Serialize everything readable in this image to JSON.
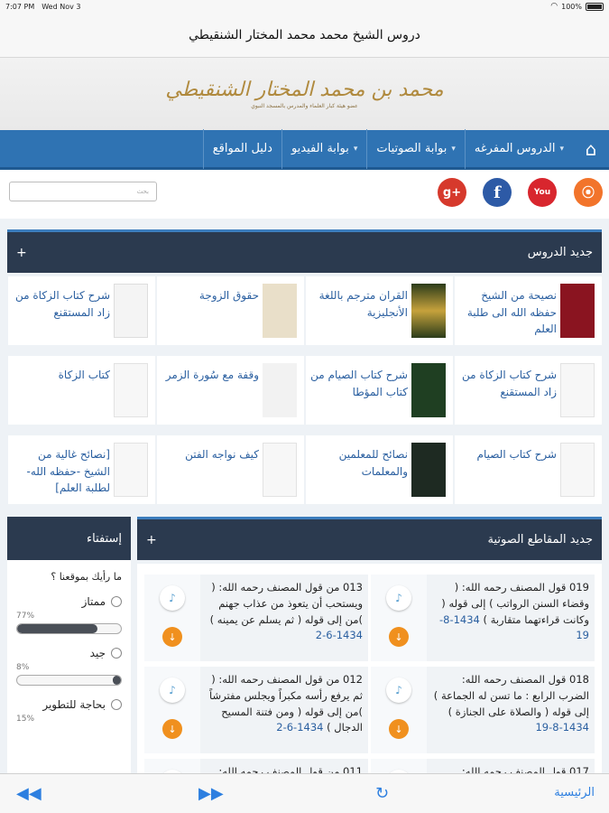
{
  "status": {
    "time": "7:07 PM",
    "date": "Wed Nov 3",
    "battery": "100%"
  },
  "title": "دروس الشيخ محمد محمد المختار الشنقيطي",
  "logo": {
    "main": "محمد بن محمد المختار الشنقيطي",
    "sub": "عضو هيئة كبار العلماء والمدرس بالمسجد النبوي"
  },
  "nav": {
    "items": [
      "الدروس المفرغه",
      "بوابة الصوتيات",
      "بوابة الفيديو",
      "دليل المواقع"
    ]
  },
  "search": {
    "placeholder": "بحث"
  },
  "social": {
    "google": "g+",
    "facebook": "f",
    "youtube": "You",
    "rss": "rss"
  },
  "lessons": {
    "header": "جديد الدروس",
    "plus": "+",
    "items": [
      "نصيحة من الشيخ حفظه الله الى طلبة العلم",
      "القران مترجم باللغة الأنجليزية",
      "حقوق الزوجة",
      "شرح كتاب الزكاة من زاد المستقنع",
      "شرح كتاب الزكاة من زاد المستقنع",
      "شرح كتاب الصيام من كتاب المؤطا",
      "وقفة مع سُورة الزمر",
      "كتاب الزكاة",
      "شرح كتاب الصيام",
      "نصائح للمعلمين والمعلمات",
      "كيف نواجه الفتن",
      "[نصائح غالية من الشيخ -حفظه الله- لطلبة العلم]"
    ]
  },
  "audio": {
    "header": "جديد المقاطع الصوتية",
    "plus": "+",
    "items": [
      {
        "text": "019 قول المصنف رحمه الله: ( وقضاء السنن الرواتب ) إلى قوله ( وكانت قراءتهما متقاربة )",
        "date": "1434-8-19"
      },
      {
        "text": "013 من قول المصنف رحمه الله: ( ويستحب أن يتعوذ من عذاب جهنم )من إلى قوله ( ثم يسلم عن يمينه )",
        "date": "1434-6-2"
      },
      {
        "text": "018 قول المصنف رحمه الله: الضرب الرابع : ما تسن له الجماعة ) إلى قوله ( والصلاة على الجنازة )",
        "date": "1434-8-19"
      },
      {
        "text": "012 من قول المصنف رحمه الله: ( ثم يرفع رأسه مكبراً ويجلس مفترشاً )من إلى قوله ( ومن فتنة المسيح الدجال )",
        "date": "1434-6-2"
      },
      {
        "text": "017 قول المصنف رحمه الله:",
        "date": ""
      },
      {
        "text": "011 من قول المصنف رحمه الله:",
        "date": ""
      }
    ]
  },
  "poll": {
    "header": "إستفتاء",
    "question": "ما رأيك بموقعنا ؟",
    "options": [
      {
        "label": "ممتاز",
        "pct": "77%",
        "value": 0.77
      },
      {
        "label": "جيد",
        "pct": "8%",
        "value": 0.08
      },
      {
        "label": "بحاجة للتطوير",
        "pct": "15%",
        "value": 0.15
      }
    ]
  },
  "toolbar": {
    "home": "الرئيسية"
  }
}
